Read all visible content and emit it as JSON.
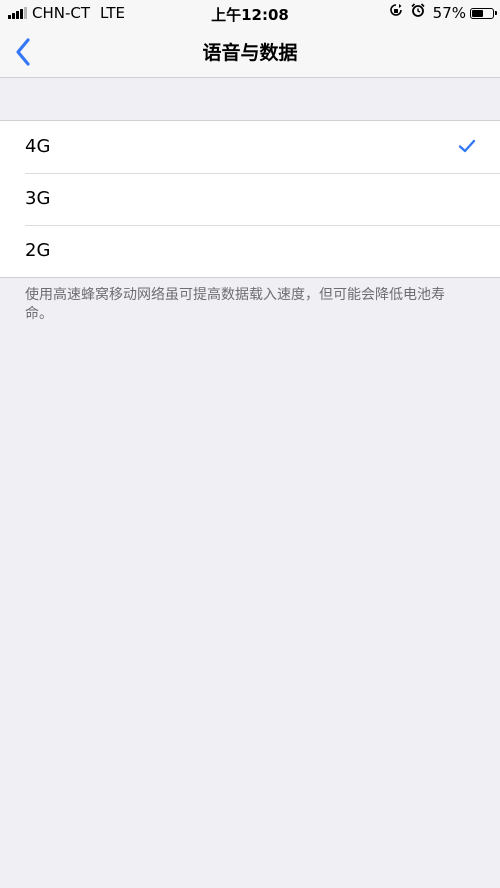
{
  "status_bar": {
    "carrier": "CHN-CT",
    "network": "LTE",
    "time": "上午12:08",
    "battery_percent": "57%",
    "battery_level": 0.57
  },
  "nav": {
    "title": "语音与数据"
  },
  "options": [
    {
      "label": "4G",
      "selected": true
    },
    {
      "label": "3G",
      "selected": false
    },
    {
      "label": "2G",
      "selected": false
    }
  ],
  "footer": "使用高速蜂窝移动网络虽可提高数据载入速度，但可能会降低电池寿命。",
  "colors": {
    "accent": "#3478f6",
    "background": "#efeff4"
  }
}
